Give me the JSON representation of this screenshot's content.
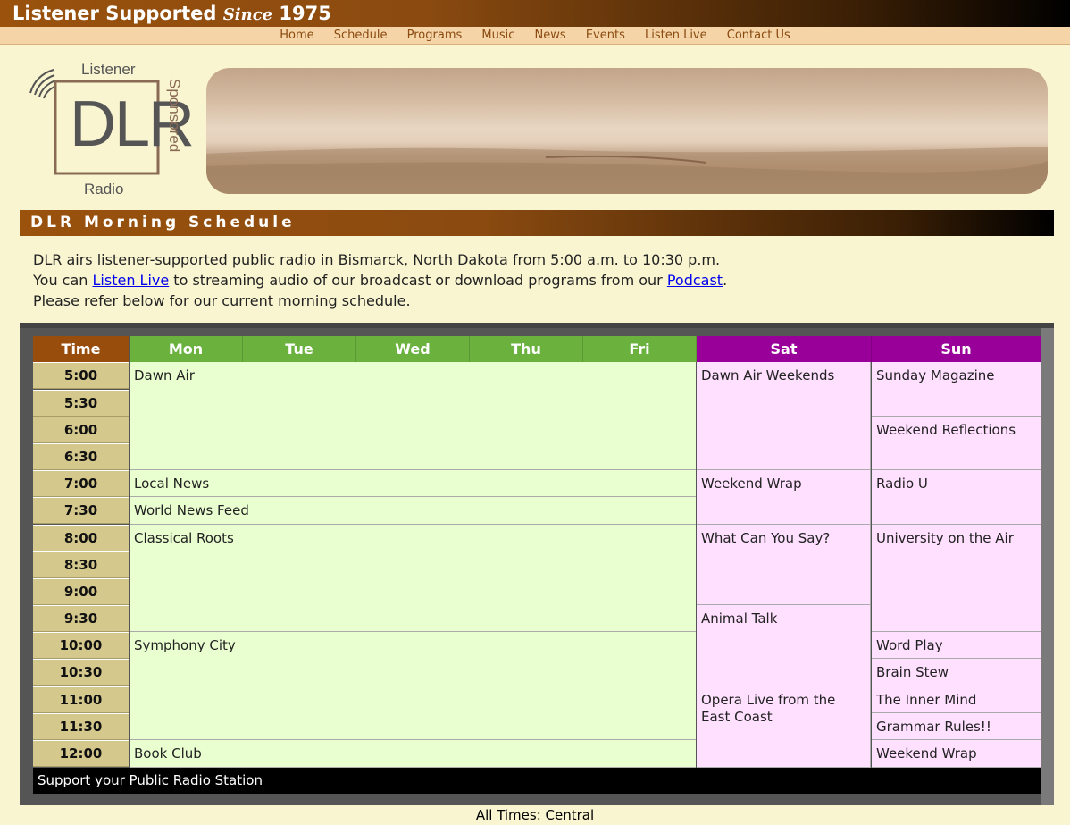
{
  "header": {
    "title_a": "Listener Supported ",
    "title_since": "Since",
    "title_year": " 1975"
  },
  "nav": [
    "Home",
    "Schedule",
    "Programs",
    "Music",
    "News",
    "Events",
    "Listen Live",
    "Contact Us"
  ],
  "logo": {
    "top_text": "Listener",
    "main_text": "DLR",
    "side_text": "Sponsored",
    "bottom_text": "Radio"
  },
  "section_title": "DLR Morning Schedule",
  "intro": {
    "line1": "DLR airs listener-supported public radio in Bismarck, North Dakota from 5:00 a.m. to 10:30 p.m.",
    "line2_a": "You can ",
    "line2_link1": "Listen Live",
    "line2_b": " to streaming audio of our broadcast or download programs from our ",
    "line2_link2": "Podcast",
    "line2_c": ".",
    "line3": "Please refer below for our current morning schedule."
  },
  "schedule": {
    "headers": {
      "time": "Time",
      "mon": "Mon",
      "tue": "Tue",
      "wed": "Wed",
      "thu": "Thu",
      "fri": "Fri",
      "sat": "Sat",
      "sun": "Sun"
    },
    "times": [
      "5:00",
      "5:30",
      "6:00",
      "6:30",
      "7:00",
      "7:30",
      "8:00",
      "8:30",
      "9:00",
      "9:30",
      "10:00",
      "10:30",
      "11:00",
      "11:30",
      "12:00"
    ],
    "weekday": [
      "Dawn Air",
      "Local News",
      "World News Feed",
      "Classical Roots",
      "Symphony City",
      "Book Club"
    ],
    "saturday": [
      "Dawn Air Weekends",
      "Weekend Wrap",
      "What Can You Say?",
      "Animal Talk",
      "Opera Live from the East Coast"
    ],
    "sunday": [
      "Sunday Magazine",
      "Weekend Reflections",
      "Radio U",
      "University on the Air",
      "Word Play",
      "Brain Stew",
      "The Inner Mind",
      "Grammar Rules!!",
      "Weekend Wrap"
    ],
    "support": "Support your Public Radio Station",
    "timezone_note": "All Times: Central"
  },
  "colors": {
    "time_header": "#994d0c",
    "weekday_header": "#6ab13e",
    "weekend_header": "#990099",
    "weekday_cell": "#eaffd0",
    "weekend_cell": "#ffe0ff",
    "time_cell": "#d4c88c"
  }
}
